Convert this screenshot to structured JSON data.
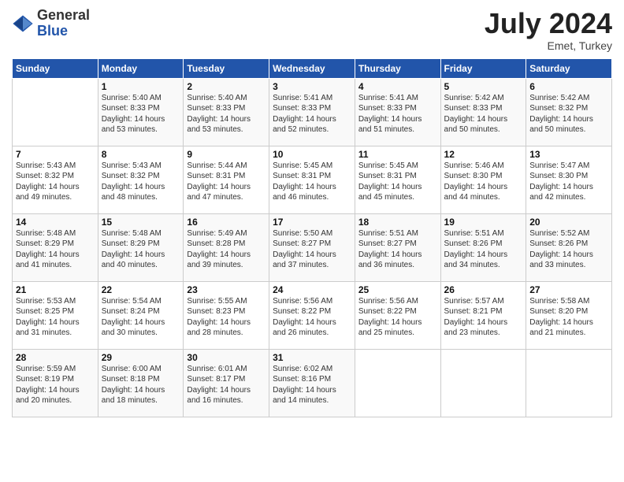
{
  "header": {
    "logo_general": "General",
    "logo_blue": "Blue",
    "month_title": "July 2024",
    "subtitle": "Emet, Turkey"
  },
  "weekdays": [
    "Sunday",
    "Monday",
    "Tuesday",
    "Wednesday",
    "Thursday",
    "Friday",
    "Saturday"
  ],
  "weeks": [
    [
      {
        "day": "",
        "info": ""
      },
      {
        "day": "1",
        "info": "Sunrise: 5:40 AM\nSunset: 8:33 PM\nDaylight: 14 hours\nand 53 minutes."
      },
      {
        "day": "2",
        "info": "Sunrise: 5:40 AM\nSunset: 8:33 PM\nDaylight: 14 hours\nand 53 minutes."
      },
      {
        "day": "3",
        "info": "Sunrise: 5:41 AM\nSunset: 8:33 PM\nDaylight: 14 hours\nand 52 minutes."
      },
      {
        "day": "4",
        "info": "Sunrise: 5:41 AM\nSunset: 8:33 PM\nDaylight: 14 hours\nand 51 minutes."
      },
      {
        "day": "5",
        "info": "Sunrise: 5:42 AM\nSunset: 8:33 PM\nDaylight: 14 hours\nand 50 minutes."
      },
      {
        "day": "6",
        "info": "Sunrise: 5:42 AM\nSunset: 8:32 PM\nDaylight: 14 hours\nand 50 minutes."
      }
    ],
    [
      {
        "day": "7",
        "info": "Sunrise: 5:43 AM\nSunset: 8:32 PM\nDaylight: 14 hours\nand 49 minutes."
      },
      {
        "day": "8",
        "info": "Sunrise: 5:43 AM\nSunset: 8:32 PM\nDaylight: 14 hours\nand 48 minutes."
      },
      {
        "day": "9",
        "info": "Sunrise: 5:44 AM\nSunset: 8:31 PM\nDaylight: 14 hours\nand 47 minutes."
      },
      {
        "day": "10",
        "info": "Sunrise: 5:45 AM\nSunset: 8:31 PM\nDaylight: 14 hours\nand 46 minutes."
      },
      {
        "day": "11",
        "info": "Sunrise: 5:45 AM\nSunset: 8:31 PM\nDaylight: 14 hours\nand 45 minutes."
      },
      {
        "day": "12",
        "info": "Sunrise: 5:46 AM\nSunset: 8:30 PM\nDaylight: 14 hours\nand 44 minutes."
      },
      {
        "day": "13",
        "info": "Sunrise: 5:47 AM\nSunset: 8:30 PM\nDaylight: 14 hours\nand 42 minutes."
      }
    ],
    [
      {
        "day": "14",
        "info": "Sunrise: 5:48 AM\nSunset: 8:29 PM\nDaylight: 14 hours\nand 41 minutes."
      },
      {
        "day": "15",
        "info": "Sunrise: 5:48 AM\nSunset: 8:29 PM\nDaylight: 14 hours\nand 40 minutes."
      },
      {
        "day": "16",
        "info": "Sunrise: 5:49 AM\nSunset: 8:28 PM\nDaylight: 14 hours\nand 39 minutes."
      },
      {
        "day": "17",
        "info": "Sunrise: 5:50 AM\nSunset: 8:27 PM\nDaylight: 14 hours\nand 37 minutes."
      },
      {
        "day": "18",
        "info": "Sunrise: 5:51 AM\nSunset: 8:27 PM\nDaylight: 14 hours\nand 36 minutes."
      },
      {
        "day": "19",
        "info": "Sunrise: 5:51 AM\nSunset: 8:26 PM\nDaylight: 14 hours\nand 34 minutes."
      },
      {
        "day": "20",
        "info": "Sunrise: 5:52 AM\nSunset: 8:26 PM\nDaylight: 14 hours\nand 33 minutes."
      }
    ],
    [
      {
        "day": "21",
        "info": "Sunrise: 5:53 AM\nSunset: 8:25 PM\nDaylight: 14 hours\nand 31 minutes."
      },
      {
        "day": "22",
        "info": "Sunrise: 5:54 AM\nSunset: 8:24 PM\nDaylight: 14 hours\nand 30 minutes."
      },
      {
        "day": "23",
        "info": "Sunrise: 5:55 AM\nSunset: 8:23 PM\nDaylight: 14 hours\nand 28 minutes."
      },
      {
        "day": "24",
        "info": "Sunrise: 5:56 AM\nSunset: 8:22 PM\nDaylight: 14 hours\nand 26 minutes."
      },
      {
        "day": "25",
        "info": "Sunrise: 5:56 AM\nSunset: 8:22 PM\nDaylight: 14 hours\nand 25 minutes."
      },
      {
        "day": "26",
        "info": "Sunrise: 5:57 AM\nSunset: 8:21 PM\nDaylight: 14 hours\nand 23 minutes."
      },
      {
        "day": "27",
        "info": "Sunrise: 5:58 AM\nSunset: 8:20 PM\nDaylight: 14 hours\nand 21 minutes."
      }
    ],
    [
      {
        "day": "28",
        "info": "Sunrise: 5:59 AM\nSunset: 8:19 PM\nDaylight: 14 hours\nand 20 minutes."
      },
      {
        "day": "29",
        "info": "Sunrise: 6:00 AM\nSunset: 8:18 PM\nDaylight: 14 hours\nand 18 minutes."
      },
      {
        "day": "30",
        "info": "Sunrise: 6:01 AM\nSunset: 8:17 PM\nDaylight: 14 hours\nand 16 minutes."
      },
      {
        "day": "31",
        "info": "Sunrise: 6:02 AM\nSunset: 8:16 PM\nDaylight: 14 hours\nand 14 minutes."
      },
      {
        "day": "",
        "info": ""
      },
      {
        "day": "",
        "info": ""
      },
      {
        "day": "",
        "info": ""
      }
    ]
  ]
}
